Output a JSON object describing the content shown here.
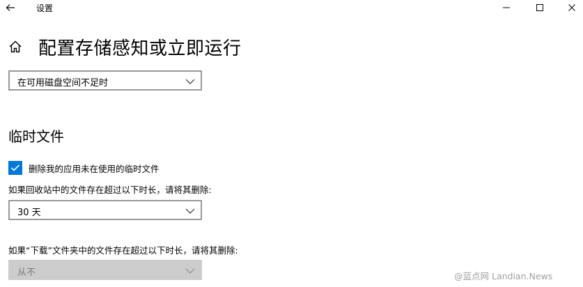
{
  "window": {
    "title": "设置",
    "icons": {
      "back": "back-arrow-icon",
      "minimize": "minimize-icon",
      "maximize": "maximize-icon",
      "close": "close-icon"
    }
  },
  "page": {
    "home_icon": "home-icon",
    "title": "配置存储感知或立即运行"
  },
  "storage_trigger": {
    "selected": "在可用磁盘空间不足时"
  },
  "temp_files": {
    "section_title": "临时文件",
    "delete_unused_checkbox": {
      "label": "删除我的应用未在使用的临时文件",
      "checked": true
    },
    "recycle_bin": {
      "label": "如果回收站中的文件存在超过以下时长，请将其删除:",
      "selected": "30 天"
    },
    "downloads": {
      "label": "如果“下载”文件夹中的文件存在超过以下时长，请将其删除:",
      "selected": "从不",
      "disabled": true
    }
  },
  "watermark": {
    "text": "@蓝点网 Landian.News"
  },
  "colors": {
    "accent": "#0078d7",
    "dropdown_border": "#999999",
    "disabled_bg": "#cccccc",
    "disabled_text": "#7a7a7a",
    "watermark": "#a0a0a0"
  }
}
